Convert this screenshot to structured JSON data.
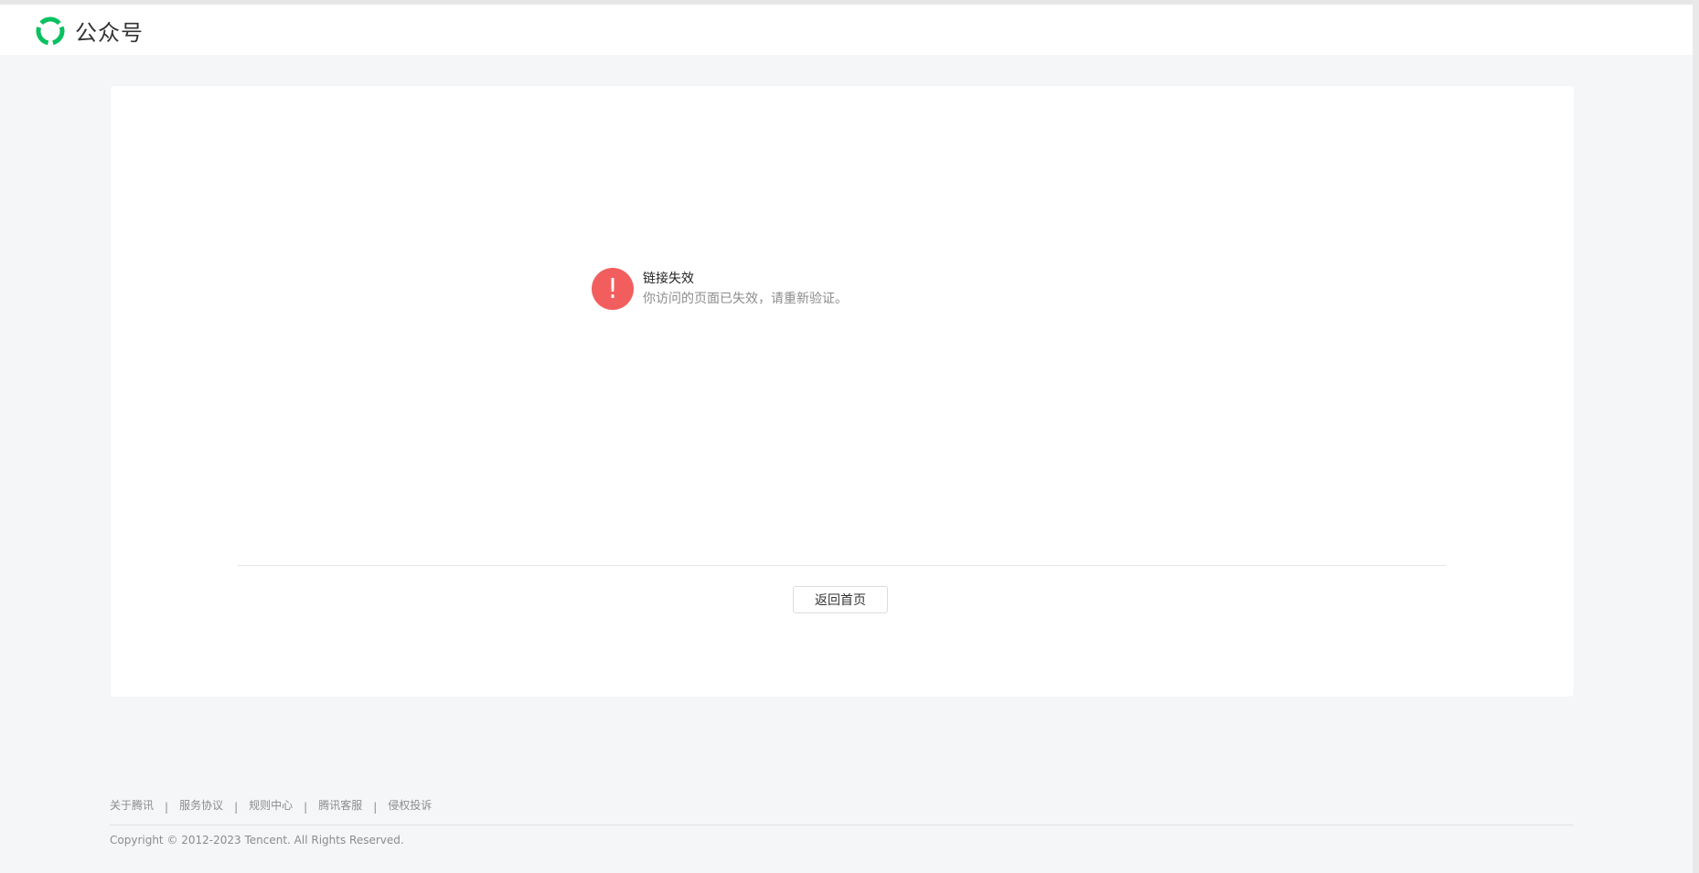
{
  "header": {
    "logo_text": "公众号",
    "logo_icon": "wechat-official-account-logo-icon",
    "logo_color": "#07c160"
  },
  "message": {
    "icon": "exclamation-icon",
    "icon_glyph": "!",
    "icon_color": "#f25e5e",
    "title": "链接失效",
    "description": "你访问的页面已失效，请重新验证。"
  },
  "actions": {
    "home_label": "返回首页"
  },
  "footer": {
    "links": [
      {
        "label": "关于腾讯"
      },
      {
        "label": "服务协议"
      },
      {
        "label": "规则中心"
      },
      {
        "label": "腾讯客服"
      },
      {
        "label": "侵权投诉"
      }
    ],
    "separator": "|",
    "copyright": "Copyright © 2012-2023 Tencent. All Rights Reserved."
  }
}
